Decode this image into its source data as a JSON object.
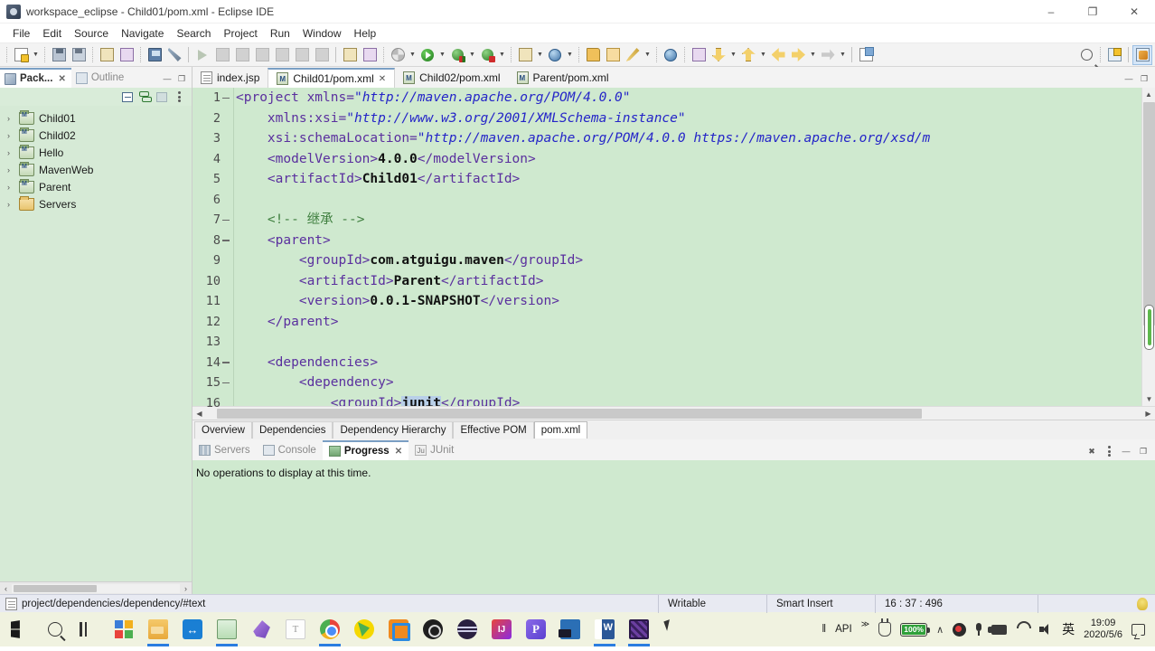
{
  "window": {
    "title": "workspace_eclipse - Child01/pom.xml - Eclipse IDE",
    "minimize": "–",
    "maximize": "❐",
    "close": "✕"
  },
  "menubar": [
    "File",
    "Edit",
    "Source",
    "Navigate",
    "Search",
    "Project",
    "Run",
    "Window",
    "Help"
  ],
  "left_view": {
    "tabs": [
      {
        "label": "Pack...",
        "icon": "package-explorer-icon",
        "active": true,
        "close": "✕"
      },
      {
        "label": "Outline",
        "icon": "outline-icon",
        "active": false
      }
    ],
    "minimize": "—",
    "maximize": "❐",
    "toolbar_icons": [
      "collapse-all-icon",
      "link-with-editor-icon",
      "view-menu-icon",
      "view-options-icon"
    ],
    "tree": [
      {
        "label": "Child01",
        "icon": "maven-project-icon",
        "arrow": "›"
      },
      {
        "label": "Child02",
        "icon": "maven-project-icon",
        "arrow": "›"
      },
      {
        "label": "Hello",
        "icon": "maven-project-icon",
        "arrow": "›"
      },
      {
        "label": "MavenWeb",
        "icon": "maven-project-icon",
        "arrow": "›"
      },
      {
        "label": "Parent",
        "icon": "maven-project-icon",
        "arrow": "›"
      },
      {
        "label": "Servers",
        "icon": "folder-icon",
        "arrow": "›"
      }
    ]
  },
  "editor": {
    "tabs": [
      {
        "label": "index.jsp",
        "icon": "jsp-file-icon",
        "active": false
      },
      {
        "label": "Child01/pom.xml",
        "icon": "maven-pom-icon",
        "active": true,
        "close": "✕"
      },
      {
        "label": "Child02/pom.xml",
        "icon": "maven-pom-icon",
        "active": false
      },
      {
        "label": "Parent/pom.xml",
        "icon": "maven-pom-icon",
        "active": false
      }
    ],
    "lines": [
      {
        "num": "1",
        "fold": true,
        "segments": [
          {
            "t": "<project ",
            "c": "tg"
          },
          {
            "t": "xmlns=",
            "c": "at"
          },
          {
            "t": "\"http://maven.apache.org/POM/4.0.0\"",
            "c": "av"
          }
        ],
        "indent": 0
      },
      {
        "num": "2",
        "fold": false,
        "segments": [
          {
            "t": "xmlns:xsi=",
            "c": "at"
          },
          {
            "t": "\"http://www.w3.org/2001/XMLSchema-instance\"",
            "c": "av"
          }
        ],
        "indent": 4
      },
      {
        "num": "3",
        "fold": false,
        "segments": [
          {
            "t": "xsi:schemaLocation=",
            "c": "at"
          },
          {
            "t": "\"http://maven.apache.org/POM/4.0.0 https://maven.apache.org/xsd/m",
            "c": "av"
          }
        ],
        "indent": 4
      },
      {
        "num": "4",
        "fold": false,
        "segments": [
          {
            "t": "<modelVersion>",
            "c": "tg"
          },
          {
            "t": "4.0.0",
            "c": "tx"
          },
          {
            "t": "</modelVersion>",
            "c": "tg"
          }
        ],
        "indent": 4
      },
      {
        "num": "5",
        "fold": false,
        "segments": [
          {
            "t": "<artifactId>",
            "c": "tg"
          },
          {
            "t": "Child01",
            "c": "tx"
          },
          {
            "t": "</artifactId>",
            "c": "tg"
          }
        ],
        "indent": 4
      },
      {
        "num": "6",
        "fold": false,
        "segments": [],
        "indent": 0
      },
      {
        "num": "7",
        "fold": true,
        "segments": [
          {
            "t": "<!-- 继承 -->",
            "c": "cm"
          }
        ],
        "indent": 4
      },
      {
        "num": "8",
        "fold": true,
        "segments": [
          {
            "t": "<parent>",
            "c": "tg"
          }
        ],
        "indent": 4
      },
      {
        "num": "9",
        "fold": false,
        "segments": [
          {
            "t": "<groupId>",
            "c": "tg"
          },
          {
            "t": "com.atguigu.maven",
            "c": "tx"
          },
          {
            "t": "</groupId>",
            "c": "tg"
          }
        ],
        "indent": 8
      },
      {
        "num": "10",
        "fold": false,
        "segments": [
          {
            "t": "<artifactId>",
            "c": "tg"
          },
          {
            "t": "Parent",
            "c": "tx"
          },
          {
            "t": "</artifactId>",
            "c": "tg"
          }
        ],
        "indent": 8
      },
      {
        "num": "11",
        "fold": false,
        "segments": [
          {
            "t": "<version>",
            "c": "tg"
          },
          {
            "t": "0.0.1-SNAPSHOT",
            "c": "tx"
          },
          {
            "t": "</version>",
            "c": "tg"
          }
        ],
        "indent": 8
      },
      {
        "num": "12",
        "fold": false,
        "segments": [
          {
            "t": "</parent>",
            "c": "tg"
          }
        ],
        "indent": 4
      },
      {
        "num": "13",
        "fold": false,
        "segments": [],
        "indent": 0
      },
      {
        "num": "14",
        "fold": true,
        "segments": [
          {
            "t": "<dependencies>",
            "c": "tg"
          }
        ],
        "indent": 4
      },
      {
        "num": "15",
        "fold": true,
        "segments": [
          {
            "t": "<dependency>",
            "c": "tg"
          }
        ],
        "indent": 8
      },
      {
        "num": "16",
        "fold": false,
        "segments": [
          {
            "t": "<groupId>",
            "c": "tg"
          },
          {
            "t": "junit",
            "c": "tx sel"
          },
          {
            "t": "</groupId>",
            "c": "tg"
          }
        ],
        "indent": 12
      }
    ],
    "pom_tabs": [
      {
        "label": "Overview",
        "active": false
      },
      {
        "label": "Dependencies",
        "active": false
      },
      {
        "label": "Dependency Hierarchy",
        "active": false
      },
      {
        "label": "Effective POM",
        "active": false
      },
      {
        "label": "pom.xml",
        "active": true
      }
    ]
  },
  "bottom_panel": {
    "tabs": [
      {
        "label": "Servers",
        "icon": "servers-icon",
        "active": false
      },
      {
        "label": "Console",
        "icon": "console-icon",
        "active": false
      },
      {
        "label": "Progress",
        "icon": "progress-icon",
        "active": true,
        "close": "✕"
      },
      {
        "label": "JUnit",
        "icon": "junit-icon",
        "active": false
      }
    ],
    "message": "No operations to display at this time.",
    "toolbar_icons": [
      "cancel-all-icon",
      "view-menu-icon",
      "minimize-icon",
      "maximize-icon"
    ]
  },
  "statusbar": {
    "breadcrumb": "project/dependencies/dependency/#text",
    "writable": "Writable",
    "insert_mode": "Smart Insert",
    "cursor_position": "16 : 37 : 496"
  },
  "taskbar": {
    "items": [
      {
        "name": "start-button",
        "icon": "windows-logo-icon"
      },
      {
        "name": "search-button",
        "icon": "search-icon"
      },
      {
        "name": "task-view-button",
        "icon": "task-view-icon"
      },
      {
        "name": "microsoft-store",
        "icon": "microsoft-store-icon"
      },
      {
        "name": "file-explorer",
        "icon": "file-explorer-icon",
        "running": true
      },
      {
        "name": "teamviewer",
        "icon": "teamviewer-icon"
      },
      {
        "name": "snipaste",
        "icon": "snipaste-icon",
        "running": true
      },
      {
        "name": "dolphin-app",
        "icon": "dolphin-icon"
      },
      {
        "name": "typora",
        "icon": "typora-icon"
      },
      {
        "name": "google-chrome",
        "icon": "chrome-icon",
        "running": true
      },
      {
        "name": "yy-app",
        "icon": "yy-icon"
      },
      {
        "name": "vmware",
        "icon": "vmware-icon"
      },
      {
        "name": "obs-studio",
        "icon": "obs-icon"
      },
      {
        "name": "navicat",
        "icon": "navicat-icon"
      },
      {
        "name": "intellij-idea",
        "icon": "intellij-idea-icon"
      },
      {
        "name": "pycharm",
        "icon": "pycharm-icon"
      },
      {
        "name": "virtualbox",
        "icon": "virtualbox-icon"
      },
      {
        "name": "microsoft-word",
        "icon": "word-icon",
        "running": true
      },
      {
        "name": "eclipse-ide",
        "icon": "eclipse-icon",
        "running": true
      }
    ],
    "tray": {
      "api_label": "API",
      "overflow": "≫",
      "battery_percent": "100%",
      "chevron": "∧",
      "ime": "英",
      "time": "19:09",
      "date": "2020/5/6",
      "icons": [
        "plug-icon",
        "battery-icon",
        "chevron-up-icon",
        "recording-icon",
        "microphone-icon",
        "camera-icon",
        "network-icon",
        "volume-icon",
        "notification-icon"
      ]
    }
  }
}
